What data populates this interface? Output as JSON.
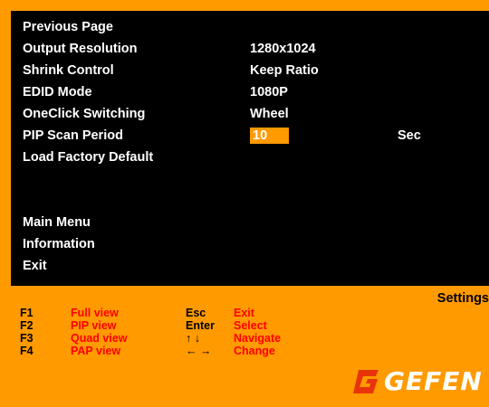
{
  "colors": {
    "background": "#FF9A00",
    "panel": "#000000",
    "highlight": "#FF9A00",
    "fn_text": "#FF0000"
  },
  "menu": {
    "items": [
      {
        "label": "Previous Page"
      },
      {
        "label": "Output Resolution",
        "value": "1280x1024"
      },
      {
        "label": "Shrink Control",
        "value": "Keep Ratio"
      },
      {
        "label": "EDID Mode",
        "value": "1080P"
      },
      {
        "label": "OneClick Switching",
        "value": "Wheel"
      },
      {
        "label": "PIP Scan Period",
        "value": "10",
        "unit": "Sec"
      },
      {
        "label": "Load Factory Default"
      }
    ],
    "bottom_items": [
      {
        "label": "Main Menu"
      },
      {
        "label": "Information"
      },
      {
        "label": "Exit"
      }
    ]
  },
  "footer": {
    "title": "Settings",
    "legend": [
      {
        "key": "F1",
        "function": "Full view",
        "key2": "Esc",
        "action": "Exit"
      },
      {
        "key": "F2",
        "function": "PIP view",
        "key2": "Enter",
        "action": "Select"
      },
      {
        "key": "F3",
        "function": "Quad view",
        "key2": "↑ ↓",
        "action": "Navigate"
      },
      {
        "key": "F4",
        "function": "PAP view",
        "key2": "← →",
        "action": "Change"
      }
    ],
    "logo": {
      "text": "GEFEN",
      "icon": "gefen-g-icon"
    }
  }
}
